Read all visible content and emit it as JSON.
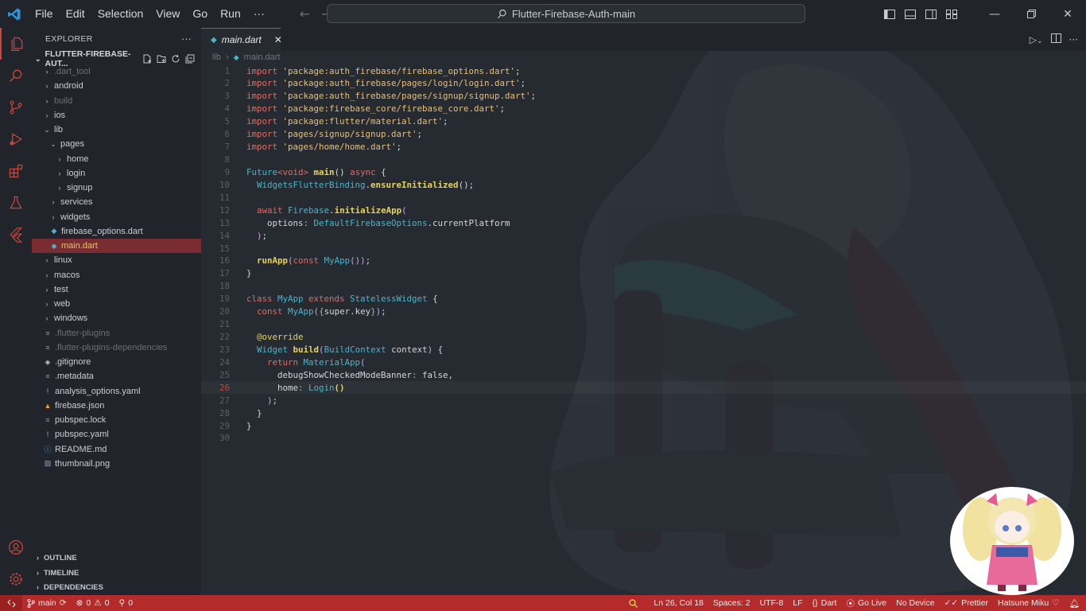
{
  "titlebar": {
    "menus": [
      "File",
      "Edit",
      "Selection",
      "View",
      "Go",
      "Run",
      "···"
    ],
    "search": "Flutter-Firebase-Auth-main"
  },
  "explorer": {
    "title": "EXPLORER",
    "folder": "FLUTTER-FIREBASE-AUT...",
    "tree": [
      {
        "label": ".dart_tool",
        "depth": 0,
        "kind": "folder",
        "dim": true
      },
      {
        "label": "android",
        "depth": 0,
        "kind": "folder"
      },
      {
        "label": "build",
        "depth": 0,
        "kind": "folder",
        "dim": true
      },
      {
        "label": "ios",
        "depth": 0,
        "kind": "folder"
      },
      {
        "label": "lib",
        "depth": 0,
        "kind": "folder-open"
      },
      {
        "label": "pages",
        "depth": 1,
        "kind": "folder-open"
      },
      {
        "label": "home",
        "depth": 2,
        "kind": "folder"
      },
      {
        "label": "login",
        "depth": 2,
        "kind": "folder"
      },
      {
        "label": "signup",
        "depth": 2,
        "kind": "folder"
      },
      {
        "label": "services",
        "depth": 1,
        "kind": "folder"
      },
      {
        "label": "widgets",
        "depth": 1,
        "kind": "folder"
      },
      {
        "label": "firebase_options.dart",
        "depth": 1,
        "kind": "dart"
      },
      {
        "label": "main.dart",
        "depth": 1,
        "kind": "dart",
        "selected": true
      },
      {
        "label": "linux",
        "depth": 0,
        "kind": "folder"
      },
      {
        "label": "macos",
        "depth": 0,
        "kind": "folder"
      },
      {
        "label": "test",
        "depth": 0,
        "kind": "folder"
      },
      {
        "label": "web",
        "depth": 0,
        "kind": "folder"
      },
      {
        "label": "windows",
        "depth": 0,
        "kind": "folder"
      },
      {
        "label": ".flutter-plugins",
        "depth": 0,
        "kind": "file",
        "dim": true
      },
      {
        "label": ".flutter-plugins-dependencies",
        "depth": 0,
        "kind": "file",
        "dim": true
      },
      {
        "label": ".gitignore",
        "depth": 0,
        "kind": "git"
      },
      {
        "label": ".metadata",
        "depth": 0,
        "kind": "file"
      },
      {
        "label": "analysis_options.yaml",
        "depth": 0,
        "kind": "yaml"
      },
      {
        "label": "firebase.json",
        "depth": 0,
        "kind": "firebase"
      },
      {
        "label": "pubspec.lock",
        "depth": 0,
        "kind": "file"
      },
      {
        "label": "pubspec.yaml",
        "depth": 0,
        "kind": "yaml"
      },
      {
        "label": "README.md",
        "depth": 0,
        "kind": "info"
      },
      {
        "label": "thumbnail.png",
        "depth": 0,
        "kind": "image"
      }
    ],
    "panels": [
      "OUTLINE",
      "TIMELINE",
      "DEPENDENCIES"
    ]
  },
  "editor": {
    "tab": "main.dart",
    "breadcrumb": [
      "lib",
      "main.dart"
    ],
    "current_line": 26,
    "lines": [
      [
        [
          "kw",
          "import "
        ],
        [
          "str",
          "'package:auth_firebase/firebase_options.dart'"
        ],
        [
          "pl",
          ";"
        ]
      ],
      [
        [
          "kw",
          "import "
        ],
        [
          "str",
          "'package:auth_firebase/pages/login/login.dart'"
        ],
        [
          "pl",
          ";"
        ]
      ],
      [
        [
          "kw",
          "import "
        ],
        [
          "str",
          "'package:auth_firebase/pages/signup/signup.dart'"
        ],
        [
          "pl",
          ";"
        ]
      ],
      [
        [
          "kw",
          "import "
        ],
        [
          "str",
          "'package:firebase_core/firebase_core.dart'"
        ],
        [
          "pl",
          ";"
        ]
      ],
      [
        [
          "kw",
          "import "
        ],
        [
          "str",
          "'package:flutter/material.dart'"
        ],
        [
          "pl",
          ";"
        ]
      ],
      [
        [
          "kw",
          "import "
        ],
        [
          "str",
          "'pages/signup/signup.dart'"
        ],
        [
          "pl",
          ";"
        ]
      ],
      [
        [
          "kw",
          "import "
        ],
        [
          "str",
          "'pages/home/home.dart'"
        ],
        [
          "pl",
          ";"
        ]
      ],
      [],
      [
        [
          "ty",
          "Future"
        ],
        [
          "kw",
          "<void>"
        ],
        [
          "pl",
          " "
        ],
        [
          "fn",
          "main"
        ],
        [
          "pl",
          "() "
        ],
        [
          "kw",
          "async"
        ],
        [
          "pl",
          " {"
        ]
      ],
      [
        [
          "pl",
          "  "
        ],
        [
          "ty",
          "WidgetsFlutterBinding"
        ],
        [
          "pl",
          "."
        ],
        [
          "fn",
          "ensureInitialized"
        ],
        [
          "pl",
          "();"
        ]
      ],
      [],
      [
        [
          "pl",
          "  "
        ],
        [
          "kw",
          "await "
        ],
        [
          "ty",
          "Firebase"
        ],
        [
          "pl",
          "."
        ],
        [
          "fn",
          "initializeApp"
        ],
        [
          "pa",
          "("
        ]
      ],
      [
        [
          "pl",
          "    options"
        ],
        [
          "pr",
          ": "
        ],
        [
          "ty",
          "DefaultFirebaseOptions"
        ],
        [
          "pl",
          ".currentPlatform"
        ]
      ],
      [
        [
          "pl",
          "  "
        ],
        [
          "pa",
          ")"
        ],
        [
          "pl",
          ";"
        ]
      ],
      [],
      [
        [
          "pl",
          "  "
        ],
        [
          "fn",
          "runApp"
        ],
        [
          "pa",
          "("
        ],
        [
          "kw",
          "const "
        ],
        [
          "ty",
          "MyApp"
        ],
        [
          "pa",
          "()"
        ],
        [
          "pa",
          ")"
        ],
        [
          "pl",
          ";"
        ]
      ],
      [
        [
          "pl",
          "}"
        ]
      ],
      [],
      [
        [
          "kw",
          "class "
        ],
        [
          "ty",
          "MyApp "
        ],
        [
          "kw",
          "extends "
        ],
        [
          "ty",
          "StatelessWidget"
        ],
        [
          "pl",
          " {"
        ]
      ],
      [
        [
          "pl",
          "  "
        ],
        [
          "kw",
          "const "
        ],
        [
          "ty",
          "MyApp"
        ],
        [
          "pa",
          "("
        ],
        [
          "pr",
          "{"
        ],
        [
          "pl",
          "super.key"
        ],
        [
          "pr",
          "}"
        ],
        [
          "pa",
          ")"
        ],
        [
          "pl",
          ";"
        ]
      ],
      [],
      [
        [
          "pl",
          "  "
        ],
        [
          "ann",
          "@override"
        ]
      ],
      [
        [
          "pl",
          "  "
        ],
        [
          "ty",
          "Widget "
        ],
        [
          "fn",
          "build"
        ],
        [
          "pa",
          "("
        ],
        [
          "ty",
          "BuildContext "
        ],
        [
          "pl",
          "context"
        ],
        [
          "pa",
          ")"
        ],
        [
          "pl",
          " {"
        ]
      ],
      [
        [
          "pl",
          "    "
        ],
        [
          "kw",
          "return "
        ],
        [
          "ty",
          "MaterialApp"
        ],
        [
          "pa",
          "("
        ]
      ],
      [
        [
          "pl",
          "      debugShowCheckedModeBanner"
        ],
        [
          "pr",
          ": "
        ],
        [
          "pl",
          "false,"
        ]
      ],
      [
        [
          "pl",
          "      home"
        ],
        [
          "pr",
          ": "
        ],
        [
          "ty",
          "Login"
        ],
        [
          "fn",
          "()"
        ]
      ],
      [
        [
          "pl",
          "    "
        ],
        [
          "pa",
          ")"
        ],
        [
          "pl",
          ";"
        ]
      ],
      [
        [
          "pl",
          "  }"
        ]
      ],
      [
        [
          "pl",
          "}"
        ]
      ],
      []
    ]
  },
  "statusbar": {
    "branch": "main",
    "errors": "0",
    "warnings": "0",
    "ports": "0",
    "position": "Ln 26, Col 18",
    "spaces": "Spaces: 2",
    "encoding": "UTF-8",
    "eol": "LF",
    "language": "Dart",
    "golive": "Go Live",
    "device": "No Device",
    "prettier": "Prettier",
    "user": "Hatsune Miku"
  },
  "colors": {
    "accent": "#c8463c",
    "statusbar": "#b52a2a",
    "sidebar": "#21252b",
    "editor": "#262a31"
  }
}
